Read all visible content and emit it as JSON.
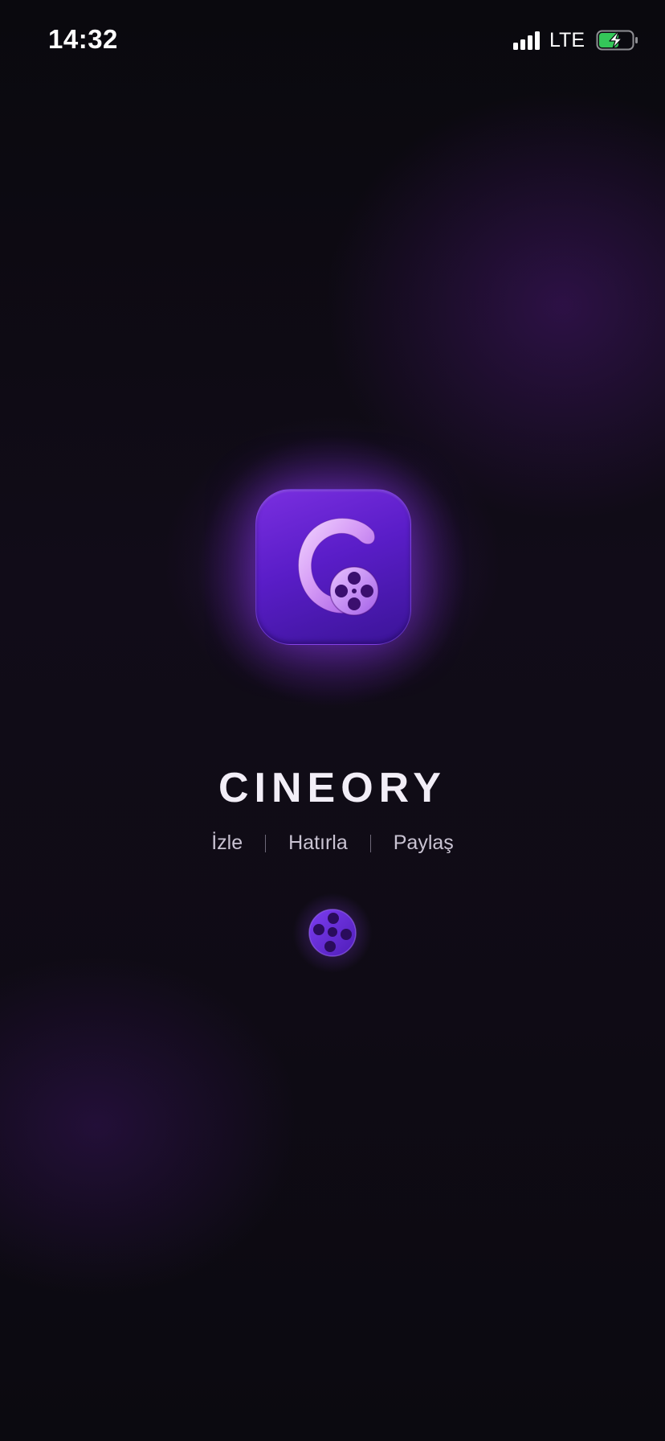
{
  "status_bar": {
    "time": "14:32",
    "network": "LTE",
    "signal_icon": "signal-bars-icon",
    "battery_icon": "battery-charging-icon",
    "battery_color": "#34c759"
  },
  "splash": {
    "logo_icon": "cineory-film-reel-logo-icon",
    "app_name": "CINEORY",
    "tagline": [
      "İzle",
      "Hatırla",
      "Paylaş"
    ],
    "loader_icon": "film-reel-icon",
    "accent_color": "#6a2ae0"
  }
}
